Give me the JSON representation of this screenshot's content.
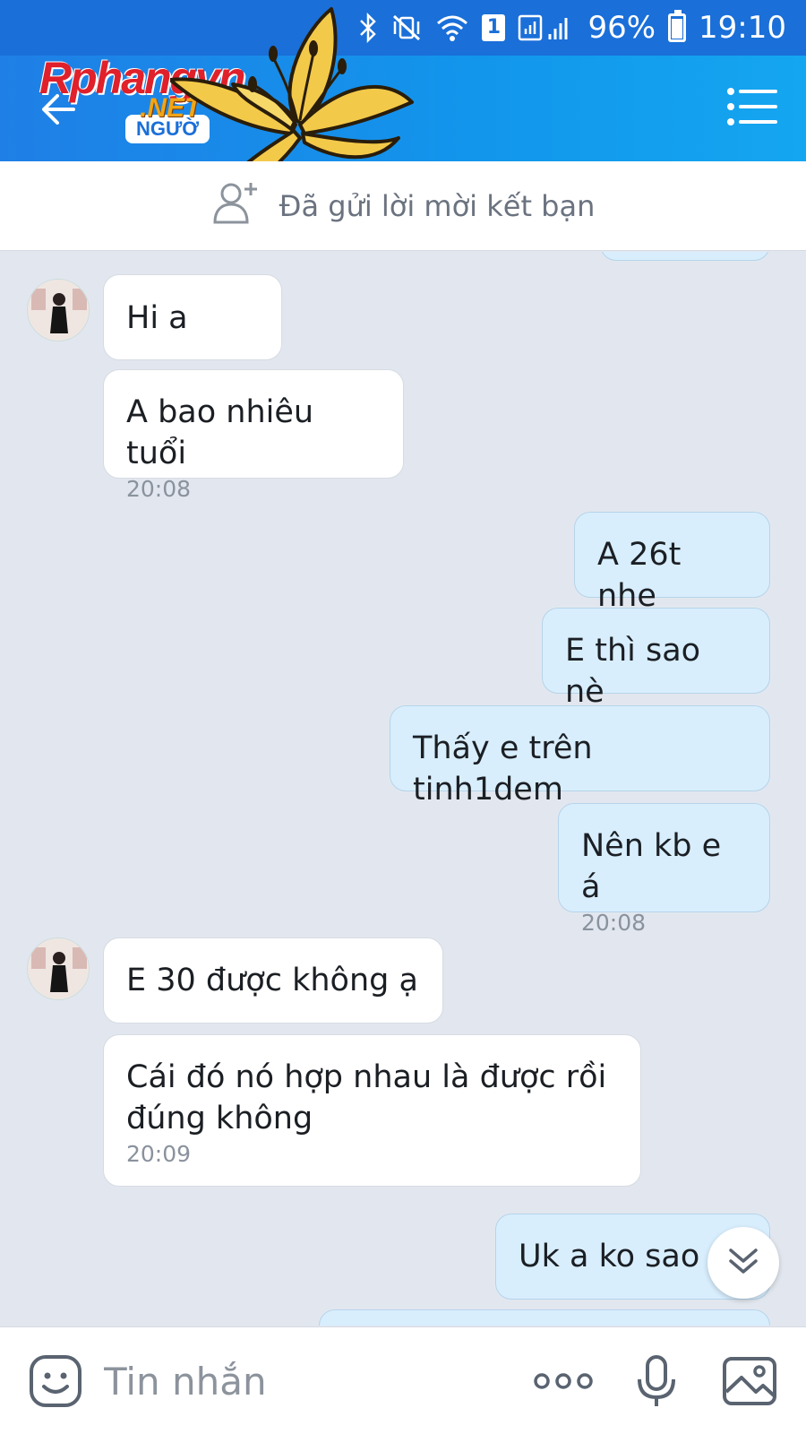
{
  "status_bar": {
    "sim_slot": "1",
    "battery": "96%",
    "time": "19:10"
  },
  "header": {
    "badge": "NGƯỜ",
    "watermark_main": "Rphangvn",
    "watermark_sub": ".NET"
  },
  "friend_request": {
    "text": "Đã gửi lời mời kết bạn"
  },
  "messages": [
    {
      "dir": "in",
      "text": "Hi a",
      "time": ""
    },
    {
      "dir": "in",
      "text": "A bao nhiêu tuổi",
      "time": "20:08"
    },
    {
      "dir": "out",
      "text": "A 26t nhe",
      "time": ""
    },
    {
      "dir": "out",
      "text": "E thì sao nè",
      "time": ""
    },
    {
      "dir": "out",
      "text": "Thấy e trên tinh1dem",
      "time": ""
    },
    {
      "dir": "out",
      "text": "Nên kb e á",
      "time": "20:08"
    },
    {
      "dir": "in",
      "text": "E 30 được không ạ",
      "time": ""
    },
    {
      "dir": "in",
      "text": "Cái đó nó hợp nhau là được rồi đúng không",
      "time": "20:09"
    },
    {
      "dir": "out",
      "text": "Uk a ko sao",
      "time": ""
    }
  ],
  "composer": {
    "placeholder": "Tin nhắn"
  },
  "icons": {
    "back": "back-arrow-icon",
    "menu": "list-menu-icon",
    "add_friend": "add-friend-icon",
    "scroll_down": "double-chevron-down-icon",
    "sticker": "sticker-face-icon",
    "more": "more-dots-icon",
    "mic": "microphone-icon",
    "image": "image-icon"
  },
  "colors": {
    "header": "#1f7fe6",
    "bubble_out": "#d8eefd",
    "bubble_in": "#ffffff",
    "chat_bg": "#e2e7ef"
  }
}
